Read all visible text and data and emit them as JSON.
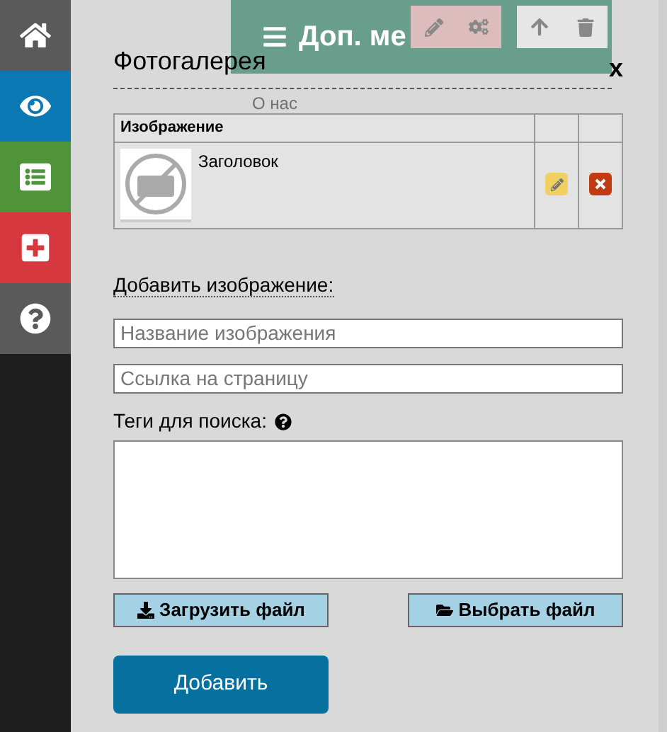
{
  "sidebar": {
    "items": [
      {
        "kind": "home",
        "color": "#5a5a5a"
      },
      {
        "kind": "eye",
        "color": "#0a79b3"
      },
      {
        "kind": "list",
        "color": "#4f9439"
      },
      {
        "kind": "plus",
        "color": "#d6393d"
      },
      {
        "kind": "help",
        "color": "#5a5a5a"
      }
    ]
  },
  "background": {
    "menu_label": "Доп. ме",
    "link": "О нас"
  },
  "dialog": {
    "title": "Фотогалерея",
    "close": "x",
    "table": {
      "columns": [
        "Изображение"
      ],
      "rows": [
        {
          "title": "Заголовок"
        }
      ]
    },
    "section_title": "Добавить изображение:",
    "fields": [
      {
        "placeholder": "Название изображения"
      },
      {
        "placeholder": "Ссылка на страницу"
      }
    ],
    "tags_label": "Теги для поиска:",
    "buttons": [
      {
        "label": "Загрузить файл",
        "kind": "download"
      },
      {
        "label": "Выбрать файл",
        "kind": "folder"
      }
    ],
    "submit": "Добавить"
  }
}
